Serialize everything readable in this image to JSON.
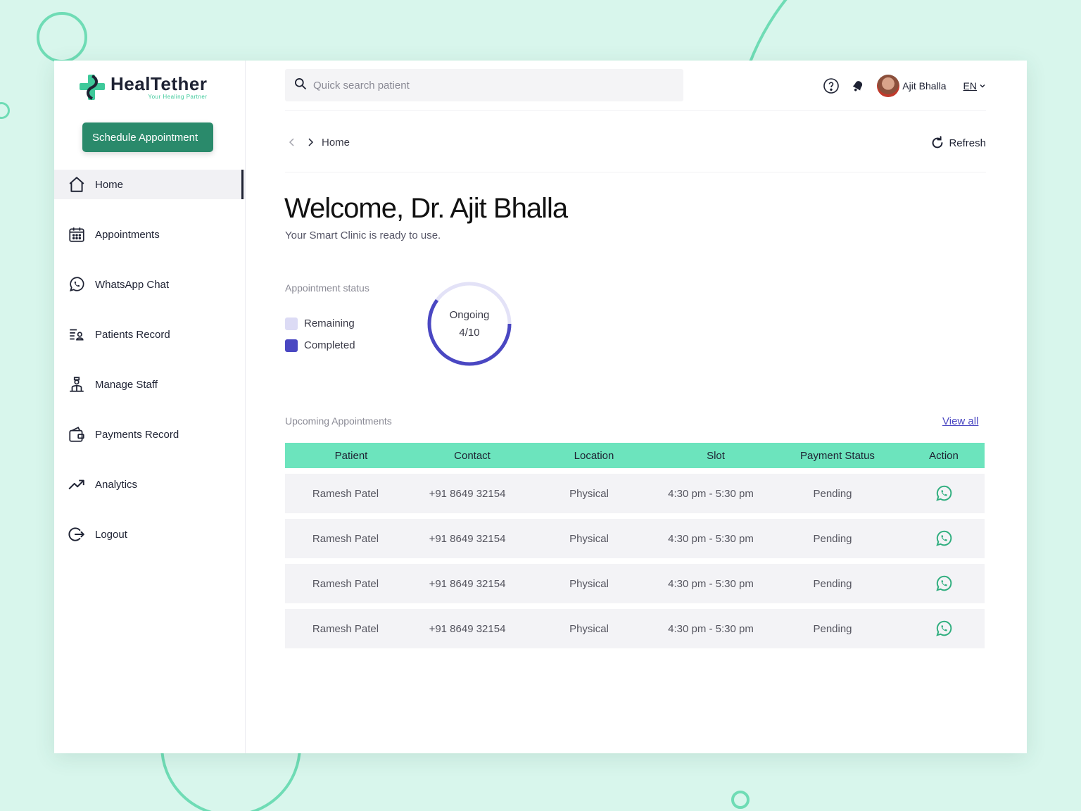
{
  "brand": {
    "name": "HealTether",
    "tagline": "Your Healing Partner",
    "accent": "#2a8a6b",
    "mint": "#6ce4bd",
    "primary": "#4a47c2"
  },
  "sidebar": {
    "schedule_button": "Schedule Appointment",
    "items": [
      {
        "label": "Home",
        "icon": "home-icon",
        "active": true
      },
      {
        "label": "Appointments",
        "icon": "calendar-icon"
      },
      {
        "label": "WhatsApp Chat",
        "icon": "whatsapp-icon"
      },
      {
        "label": "Patients Record",
        "icon": "patients-record-icon"
      },
      {
        "label": "Manage Staff",
        "icon": "staff-icon"
      },
      {
        "label": "Payments Record",
        "icon": "wallet-icon"
      },
      {
        "label": "Analytics",
        "icon": "trend-up-icon"
      },
      {
        "label": "Logout",
        "icon": "logout-icon"
      }
    ]
  },
  "header": {
    "search_placeholder": "Quick search patient",
    "user_name": "Ajit Bhalla",
    "language": "EN"
  },
  "breadcrumb": {
    "current": "Home",
    "refresh_label": "Refresh"
  },
  "welcome": {
    "title": "Welcome, Dr. Ajit Bhalla",
    "subtitle": "Your Smart Clinic is ready to use."
  },
  "status": {
    "label": "Appointment status",
    "legend": [
      {
        "label": "Remaining",
        "color": "#dcdbf5"
      },
      {
        "label": "Completed",
        "color": "#4a47c2"
      }
    ],
    "ring_title": "Ongoing",
    "ring_value": "4/10",
    "completed": 4,
    "total": 10
  },
  "upcoming": {
    "label": "Upcoming Appointments",
    "view_all": "View all",
    "columns": [
      "Patient",
      "Contact",
      "Location",
      "Slot",
      "Payment Status",
      "Action"
    ],
    "rows": [
      {
        "patient": "Ramesh Patel",
        "contact": "+91 8649 32154",
        "location": "Physical",
        "slot": "4:30 pm - 5:30 pm",
        "payment": "Pending"
      },
      {
        "patient": "Ramesh Patel",
        "contact": "+91 8649 32154",
        "location": "Physical",
        "slot": "4:30 pm - 5:30 pm",
        "payment": "Pending"
      },
      {
        "patient": "Ramesh Patel",
        "contact": "+91 8649 32154",
        "location": "Physical",
        "slot": "4:30 pm - 5:30 pm",
        "payment": "Pending"
      },
      {
        "patient": "Ramesh Patel",
        "contact": "+91 8649 32154",
        "location": "Physical",
        "slot": "4:30 pm - 5:30 pm",
        "payment": "Pending"
      }
    ]
  }
}
